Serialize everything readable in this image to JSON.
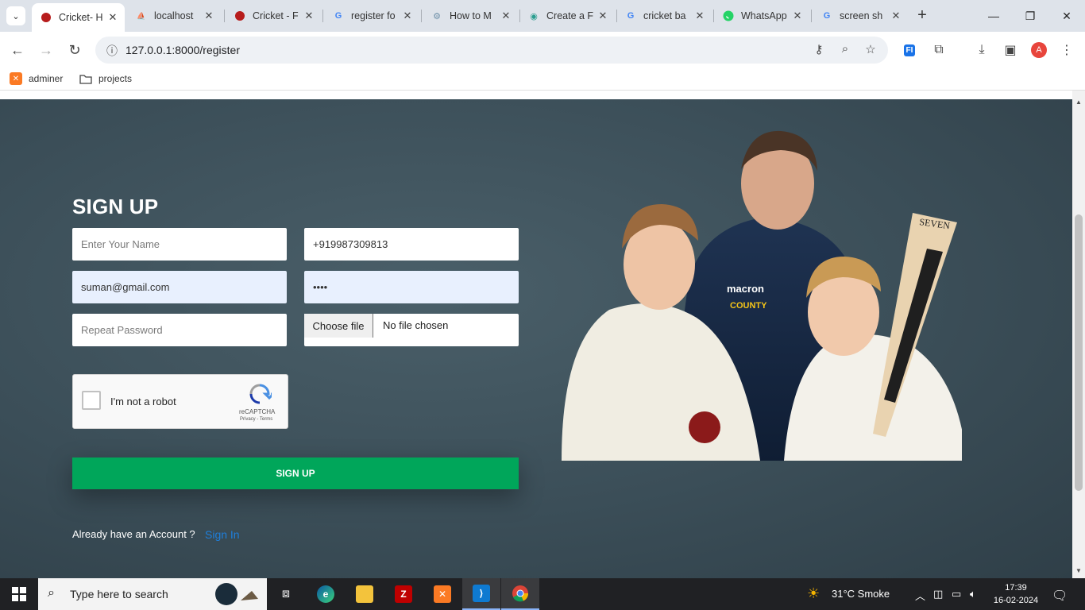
{
  "tabs": [
    {
      "label": "Cricket- H",
      "favicon": "cricket-ball-icon",
      "active": true
    },
    {
      "label": "localhost",
      "favicon": "phpmyadmin-icon"
    },
    {
      "label": "Cricket - F",
      "favicon": "cricket-ball-icon"
    },
    {
      "label": "register fo",
      "favicon": "google-icon"
    },
    {
      "label": "How to M",
      "favicon": "web-icon"
    },
    {
      "label": "Create a F",
      "favicon": "profile-web-icon"
    },
    {
      "label": "cricket ba",
      "favicon": "google-icon"
    },
    {
      "label": "WhatsApp",
      "favicon": "whatsapp-icon"
    },
    {
      "label": "screen sh",
      "favicon": "google-icon"
    }
  ],
  "address": {
    "url": "127.0.0.1:8000/register"
  },
  "profile_initial": "A",
  "bookmarks": [
    {
      "label": "adminer"
    },
    {
      "label": "projects"
    }
  ],
  "form": {
    "title": "SIGN UP",
    "name_placeholder": "Enter Your Name",
    "phone_value": "+919987309813",
    "email_value": "suman@gmail.com",
    "password_value": "••••",
    "repeat_placeholder": "Repeat Password",
    "choose_file_label": "Choose file",
    "no_file_label": "No file chosen",
    "captcha_label": "I'm not a robot",
    "captcha_brand": "reCAPTCHA",
    "captcha_terms": "Privacy - Terms",
    "submit_label": "SIGN UP",
    "account_prompt": "Already have an Account ?",
    "signin_label": "Sign In"
  },
  "colors": {
    "hero_bg": "#3b4e58",
    "submit_bg": "#00a65a",
    "signin_link": "#1e7fdc"
  },
  "taskbar": {
    "search_placeholder": "Type here to search",
    "weather": "31°C  Smoke",
    "time": "17:39",
    "date": "16-02-2024"
  }
}
